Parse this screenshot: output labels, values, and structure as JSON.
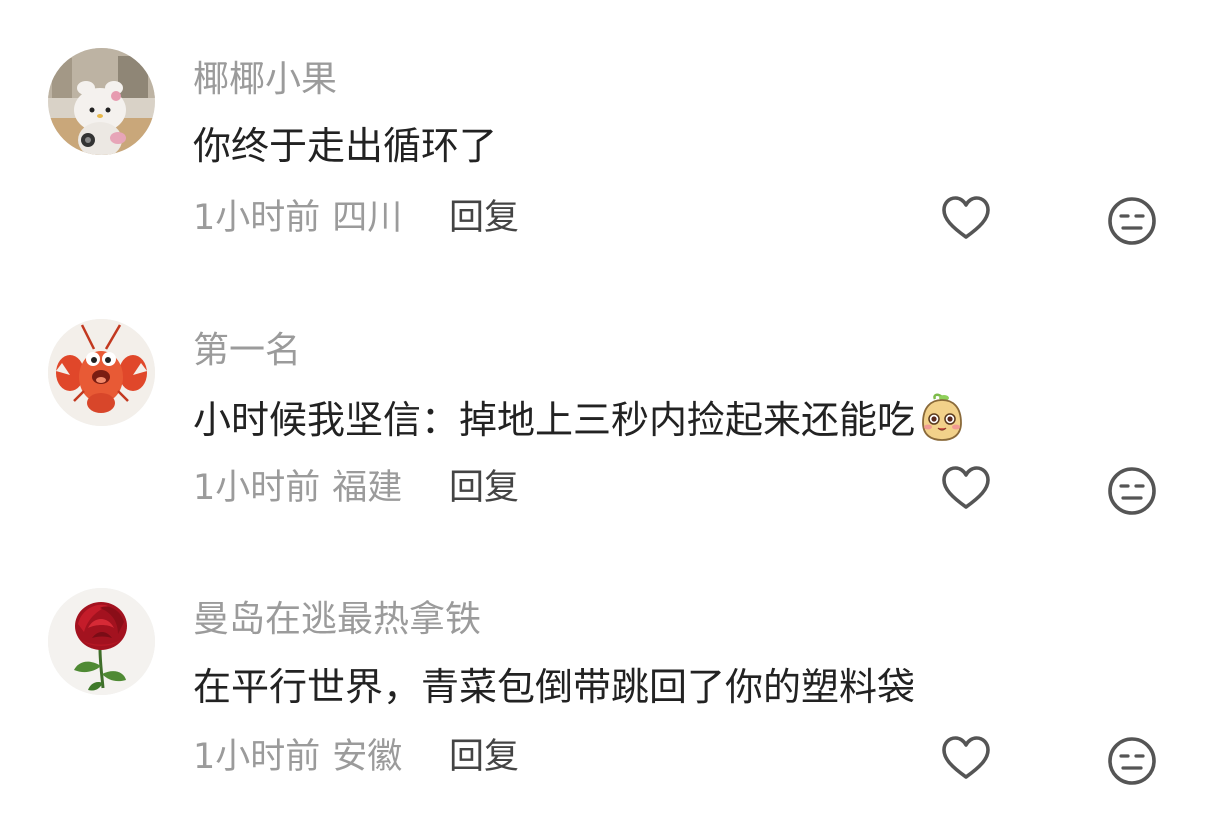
{
  "comments": [
    {
      "username": "椰椰小果",
      "content": "你终于走出循环了",
      "time": "1小时前",
      "location": "四川",
      "reply_label": "回复",
      "avatar": "hello-kitty-plush-avatar",
      "has_emoji": false
    },
    {
      "username": "第一名",
      "content": "小时候我坚信：掉地上三秒内捡起来还能吃",
      "time": "1小时前",
      "location": "福建",
      "reply_label": "回复",
      "avatar": "lobster-cartoon-avatar",
      "has_emoji": true,
      "emoji": "cute-blushing-face-sticker"
    },
    {
      "username": "曼岛在逃最热拿铁",
      "content": "在平行世界，青菜包倒带跳回了你的塑料袋",
      "time": "1小时前",
      "location": "安徽",
      "reply_label": "回复",
      "avatar": "red-rose-avatar",
      "has_emoji": false
    }
  ],
  "icons": {
    "like": "heart-outline-icon",
    "dislike": "unamused-face-icon"
  },
  "colors": {
    "username": "#9b9b9b",
    "content": "#222222",
    "meta": "#9b9b9b",
    "reply": "#444444",
    "icon": "#555555"
  }
}
